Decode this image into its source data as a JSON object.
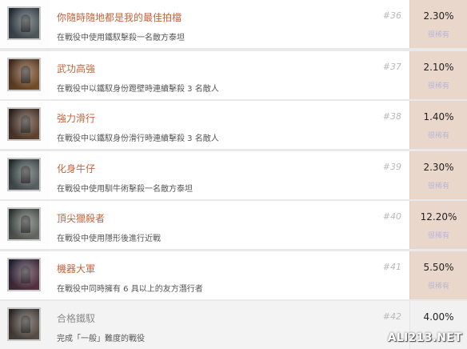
{
  "achievements": [
    {
      "name": "你隨時隨地都是我的最佳拍檔",
      "desc": "在戰役中使用鐵馭擊殺一名敵方泰坦",
      "number": "#36",
      "percent": "2.30%",
      "rarity": "很稀有",
      "thumb_colors": [
        "#2d3b46",
        "#7f8b90"
      ]
    },
    {
      "name": "武功高強",
      "desc": "在戰役中以鐵馭身份蹬壁時連續擊殺 3 名敵人",
      "number": "#37",
      "percent": "2.10%",
      "rarity": "很稀有",
      "thumb_colors": [
        "#5a3a2a",
        "#b8793f"
      ]
    },
    {
      "name": "強力滑行",
      "desc": "在戰役中以鐵馭身份滑行時連續擊殺 3 名敵人",
      "number": "#38",
      "percent": "1.40%",
      "rarity": "很稀有",
      "thumb_colors": [
        "#3a2d2a",
        "#9a6a4b"
      ]
    },
    {
      "name": "化身牛仔",
      "desc": "在戰役中使用馴牛術擊殺一名敵方泰坦",
      "number": "#39",
      "percent": "2.30%",
      "rarity": "很稀有",
      "thumb_colors": [
        "#2f3a3d",
        "#8d9a9b"
      ]
    },
    {
      "name": "頂尖獵殺者",
      "desc": "在戰役中使用隱形後進行近戰",
      "number": "#40",
      "percent": "12.20%",
      "rarity": "很稀有",
      "thumb_colors": [
        "#3c4a45",
        "#a0a49a"
      ]
    },
    {
      "name": "機器大軍",
      "desc": "在戰役中同時擁有 6 具以上的友方潛行者",
      "number": "#41",
      "percent": "5.50%",
      "rarity": "很稀有",
      "thumb_colors": [
        "#2a2c44",
        "#8b4c5f"
      ]
    },
    {
      "name": "合格鐵馭",
      "desc": "完成「一般」難度的戰役",
      "number": "#42",
      "percent": "4.00%",
      "rarity": "",
      "thumb_colors": [
        "#3b3532",
        "#8a7b70"
      ]
    }
  ],
  "watermark": "ALI213.NET"
}
